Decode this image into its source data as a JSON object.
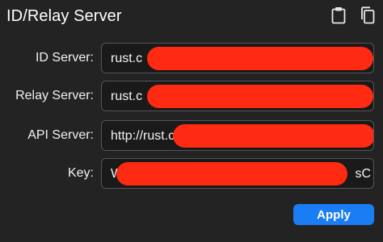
{
  "header": {
    "title": "ID/Relay Server",
    "icons": [
      "clipboard-icon",
      "copy-icon"
    ]
  },
  "fields": [
    {
      "label": "ID Server:",
      "value": "rust.c",
      "tail": ""
    },
    {
      "label": "Relay Server:",
      "value": "rust.c",
      "tail": ""
    },
    {
      "label": "API Server:",
      "value": "http://rust.c",
      "tail": ""
    },
    {
      "label": "Key:",
      "value": "W",
      "tail": "sC"
    }
  ],
  "actions": {
    "apply_label": "Apply"
  },
  "colors": {
    "accent": "#1a7df3",
    "redaction": "#ff2a12",
    "background": "#232323"
  }
}
